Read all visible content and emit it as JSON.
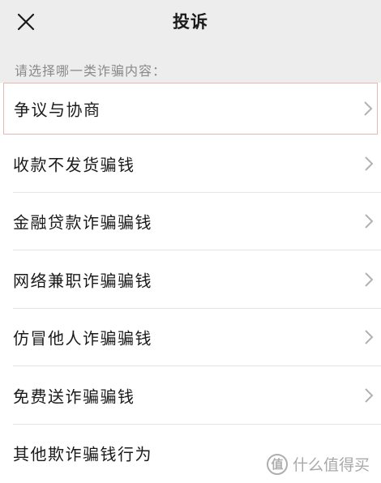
{
  "header": {
    "title": "投诉",
    "close_icon": "close-icon"
  },
  "hint": "请选择哪一类诈骗内容：",
  "items": [
    {
      "label": "争议与协商",
      "selected": true
    },
    {
      "label": "收款不发货骗钱"
    },
    {
      "label": "金融贷款诈骗骗钱"
    },
    {
      "label": "网络兼职诈骗骗钱"
    },
    {
      "label": "仿冒他人诈骗骗钱"
    },
    {
      "label": "免费送诈骗骗钱"
    },
    {
      "label": "其他欺诈骗钱行为"
    }
  ],
  "watermark": {
    "logo_text": "值",
    "text": "什么值得买"
  },
  "colors": {
    "background": "#ededed",
    "list_background": "#ffffff",
    "selected_border": "#e8b9b0",
    "hint_text": "#8a8a8a"
  }
}
